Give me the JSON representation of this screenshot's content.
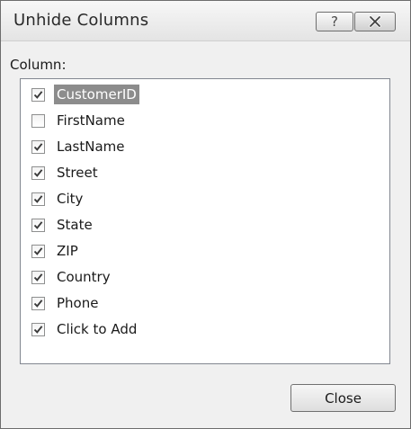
{
  "dialog": {
    "title": "Unhide Columns",
    "help_glyph": "?",
    "column_label": "Column:",
    "close_label": "Close",
    "selected_index": 0,
    "items": [
      {
        "label": "CustomerID",
        "checked": true
      },
      {
        "label": "FirstName",
        "checked": false
      },
      {
        "label": "LastName",
        "checked": true
      },
      {
        "label": "Street",
        "checked": true
      },
      {
        "label": "City",
        "checked": true
      },
      {
        "label": "State",
        "checked": true
      },
      {
        "label": "ZIP",
        "checked": true
      },
      {
        "label": "Country",
        "checked": true
      },
      {
        "label": "Phone",
        "checked": true
      },
      {
        "label": "Click to Add",
        "checked": true
      }
    ]
  },
  "icons": {
    "help": "question-mark-icon",
    "close": "close-x-icon",
    "check": "checkmark-icon"
  },
  "colors": {
    "selection_bg": "#8c8c8c",
    "window_bg": "#f0f0f0",
    "checkmark": "#3a3a3a"
  }
}
